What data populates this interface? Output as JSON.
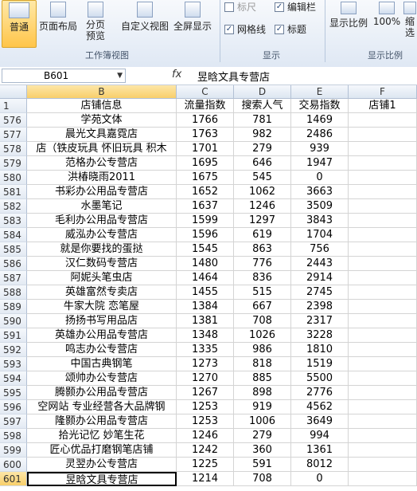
{
  "ribbon": {
    "view_normal": "普通",
    "view_page_layout": "页面布局",
    "view_page_break": "分页\n预览",
    "view_custom": "自定义视图",
    "view_fullscreen": "全屏显示",
    "group_workbook_views": "工作簿视图",
    "chk_ruler": "标尺",
    "chk_formula_bar": "编辑栏",
    "chk_gridlines": "网格线",
    "chk_headings": "标题",
    "group_show": "显示",
    "zoom": "显示比例",
    "zoom_100": "100%",
    "zoom_sel": "缩\n选",
    "group_zoom": "显示比例"
  },
  "formula_bar": {
    "name_box": "B601",
    "fx": "fx",
    "value": "昱晗文具专营店"
  },
  "columns": [
    "B",
    "C",
    "D",
    "E",
    "F"
  ],
  "header_row": {
    "num": "1",
    "b": "店铺信息",
    "c": "流量指数",
    "d": "搜索人气",
    "e": "交易指数",
    "f": "店铺1"
  },
  "rows": [
    {
      "num": "576",
      "b": "学苑文体",
      "c": "1766",
      "d": "781",
      "e": "1469"
    },
    {
      "num": "577",
      "b": "晨光文具嘉霓店",
      "c": "1763",
      "d": "982",
      "e": "2486"
    },
    {
      "num": "578",
      "b": "店（铁皮玩具 怀旧玩具 积木",
      "c": "1701",
      "d": "279",
      "e": "939"
    },
    {
      "num": "579",
      "b": "范格办公专营店",
      "c": "1695",
      "d": "646",
      "e": "1947"
    },
    {
      "num": "580",
      "b": "洪椿晓雨2011",
      "c": "1675",
      "d": "545",
      "e": "0"
    },
    {
      "num": "581",
      "b": "书彩办公用品专营店",
      "c": "1652",
      "d": "1062",
      "e": "3663"
    },
    {
      "num": "582",
      "b": "水墨笔记",
      "c": "1637",
      "d": "1246",
      "e": "3509"
    },
    {
      "num": "583",
      "b": "毛利办公用品专营店",
      "c": "1599",
      "d": "1297",
      "e": "3843"
    },
    {
      "num": "584",
      "b": "威泓办公专营店",
      "c": "1596",
      "d": "619",
      "e": "1704"
    },
    {
      "num": "585",
      "b": "就是你要找的蛋挞",
      "c": "1545",
      "d": "863",
      "e": "756"
    },
    {
      "num": "586",
      "b": "汉仁数码专营店",
      "c": "1480",
      "d": "776",
      "e": "2443"
    },
    {
      "num": "587",
      "b": "阿妮头笔虫店",
      "c": "1464",
      "d": "836",
      "e": "2914"
    },
    {
      "num": "588",
      "b": "英雄富然专卖店",
      "c": "1455",
      "d": "515",
      "e": "2745"
    },
    {
      "num": "589",
      "b": "牛家大院 恋笔屋",
      "c": "1384",
      "d": "667",
      "e": "2398"
    },
    {
      "num": "590",
      "b": "扬扬书写用品店",
      "c": "1381",
      "d": "708",
      "e": "2317"
    },
    {
      "num": "591",
      "b": "英雄办公用品专营店",
      "c": "1348",
      "d": "1026",
      "e": "3228"
    },
    {
      "num": "592",
      "b": "鸣志办公专营店",
      "c": "1335",
      "d": "986",
      "e": "1810"
    },
    {
      "num": "593",
      "b": "中国古典钢笔",
      "c": "1273",
      "d": "818",
      "e": "1519"
    },
    {
      "num": "594",
      "b": "颂帅办公专营店",
      "c": "1270",
      "d": "885",
      "e": "5500"
    },
    {
      "num": "595",
      "b": "腾颢办公用品专营店",
      "c": "1267",
      "d": "898",
      "e": "2776"
    },
    {
      "num": "596",
      "b": "空网站 专业经营各大品牌钢",
      "c": "1253",
      "d": "919",
      "e": "4562"
    },
    {
      "num": "597",
      "b": "隆颢办公用品专营店",
      "c": "1253",
      "d": "1006",
      "e": "3649"
    },
    {
      "num": "598",
      "b": "拾光记忆 妙笔生花",
      "c": "1246",
      "d": "279",
      "e": "994"
    },
    {
      "num": "599",
      "b": "匠心优品打磨钢笔店铺",
      "c": "1242",
      "d": "360",
      "e": "1361"
    },
    {
      "num": "600",
      "b": "灵翌办公专营店",
      "c": "1225",
      "d": "591",
      "e": "8012"
    },
    {
      "num": "601",
      "b": "昱晗文具专营店",
      "c": "1214",
      "d": "708",
      "e": "0"
    }
  ]
}
